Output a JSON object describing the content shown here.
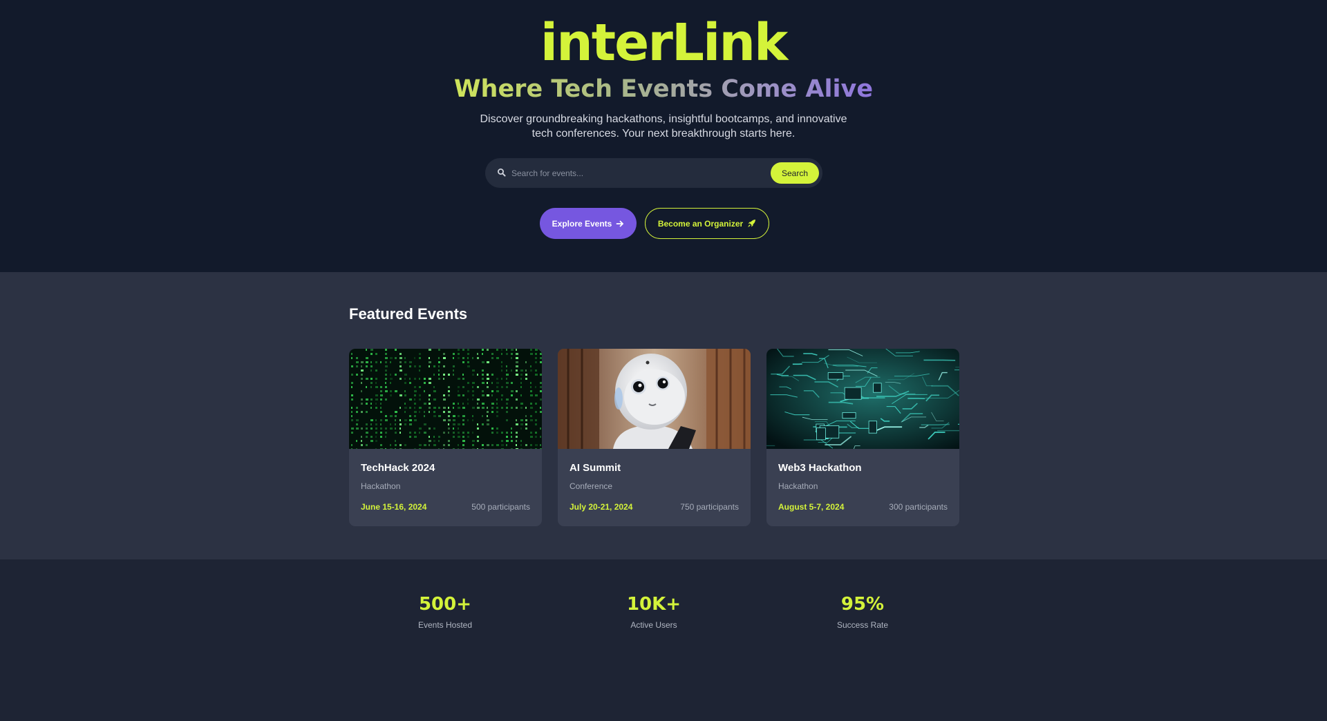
{
  "brand": {
    "name": "interLink"
  },
  "hero": {
    "tagline": "Where Tech Events Come Alive",
    "subtitle": "Discover groundbreaking hackathons, insightful bootcamps, and innovative tech conferences. Your next breakthrough starts here."
  },
  "search": {
    "placeholder": "Search for events...",
    "button_label": "Search",
    "icon": "search-icon"
  },
  "cta": {
    "explore_label": "Explore Events",
    "explore_icon": "arrow-right-icon",
    "organizer_label": "Become an Organizer",
    "organizer_icon": "rocket-icon"
  },
  "featured": {
    "title": "Featured Events",
    "events": [
      {
        "name": "TechHack 2024",
        "type": "Hackathon",
        "date": "June 15-16, 2024",
        "participants": "500 participants"
      },
      {
        "name": "AI Summit",
        "type": "Conference",
        "date": "July 20-21, 2024",
        "participants": "750 participants"
      },
      {
        "name": "Web3 Hackathon",
        "type": "Hackathon",
        "date": "August 5-7, 2024",
        "participants": "300 participants"
      }
    ]
  },
  "stats": [
    {
      "value": "500+",
      "label": "Events Hosted"
    },
    {
      "value": "10K+",
      "label": "Active Users"
    },
    {
      "value": "95%",
      "label": "Success Rate"
    }
  ],
  "colors": {
    "accent": "#d4f33a",
    "primary": "#7657e0",
    "hero_bg": "#121a2b",
    "section_bg": "#2c3243",
    "card_bg": "#3a4052"
  }
}
